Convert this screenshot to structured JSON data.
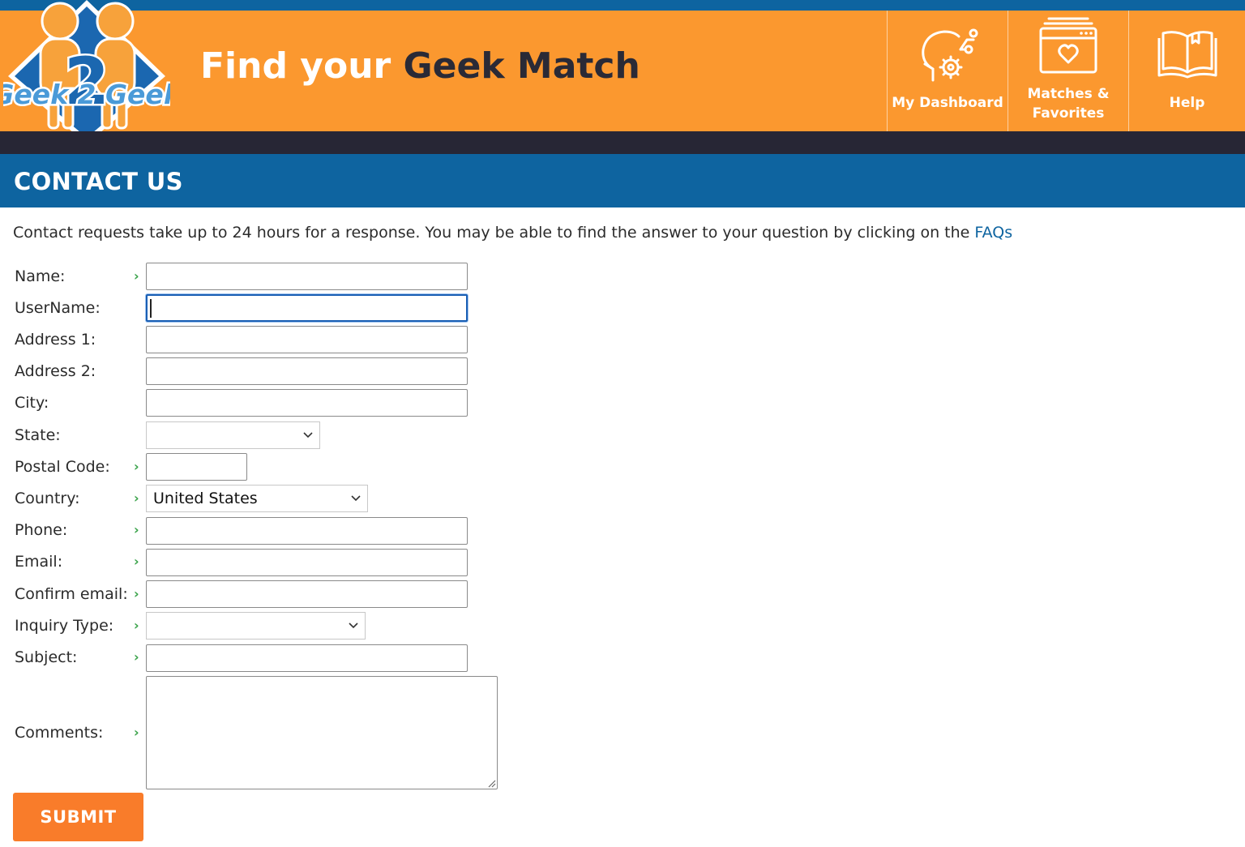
{
  "header": {
    "logo_text": "Geek 2 Geek",
    "headline_part1": "Find your",
    "headline_part2": "Geek Match",
    "nav": [
      {
        "label_line1": "My Dashboard",
        "label_line2": "",
        "icon": "head-gear-icon"
      },
      {
        "label_line1": "Matches &",
        "label_line2": "Favorites",
        "icon": "browser-heart-icon"
      },
      {
        "label_line1": "Help",
        "label_line2": "",
        "icon": "open-book-icon"
      }
    ]
  },
  "page_title": "CONTACT US",
  "intro": {
    "text": "Contact requests take up to 24 hours for a response. You may be able to find the answer to your question by clicking on the ",
    "link": "FAQs"
  },
  "form": {
    "fields": [
      {
        "label": "Name:",
        "required": true,
        "value": ""
      },
      {
        "label": "UserName:",
        "required": false,
        "value": "",
        "focused": true
      },
      {
        "label": "Address 1:",
        "required": false,
        "value": ""
      },
      {
        "label": "Address 2:",
        "required": false,
        "value": ""
      },
      {
        "label": "City:",
        "required": false,
        "value": ""
      },
      {
        "label": "State:",
        "required": false,
        "value": ""
      },
      {
        "label": "Postal Code:",
        "required": true,
        "value": ""
      },
      {
        "label": "Country:",
        "required": true,
        "value": "United States"
      },
      {
        "label": "Phone:",
        "required": true,
        "value": ""
      },
      {
        "label": "Email:",
        "required": true,
        "value": ""
      },
      {
        "label": "Confirm email:",
        "required": true,
        "value": ""
      },
      {
        "label": "Inquiry Type:",
        "required": true,
        "value": ""
      },
      {
        "label": "Subject:",
        "required": true,
        "value": ""
      },
      {
        "label": "Comments:",
        "required": true,
        "value": ""
      }
    ],
    "required_marker": "›",
    "submit_label": "SUBMIT"
  },
  "colors": {
    "header_orange": "#fb982f",
    "brand_blue": "#0e64a0",
    "dark_bar": "#272635",
    "submit_orange": "#f97c2a",
    "required_green": "#3aa34a"
  }
}
